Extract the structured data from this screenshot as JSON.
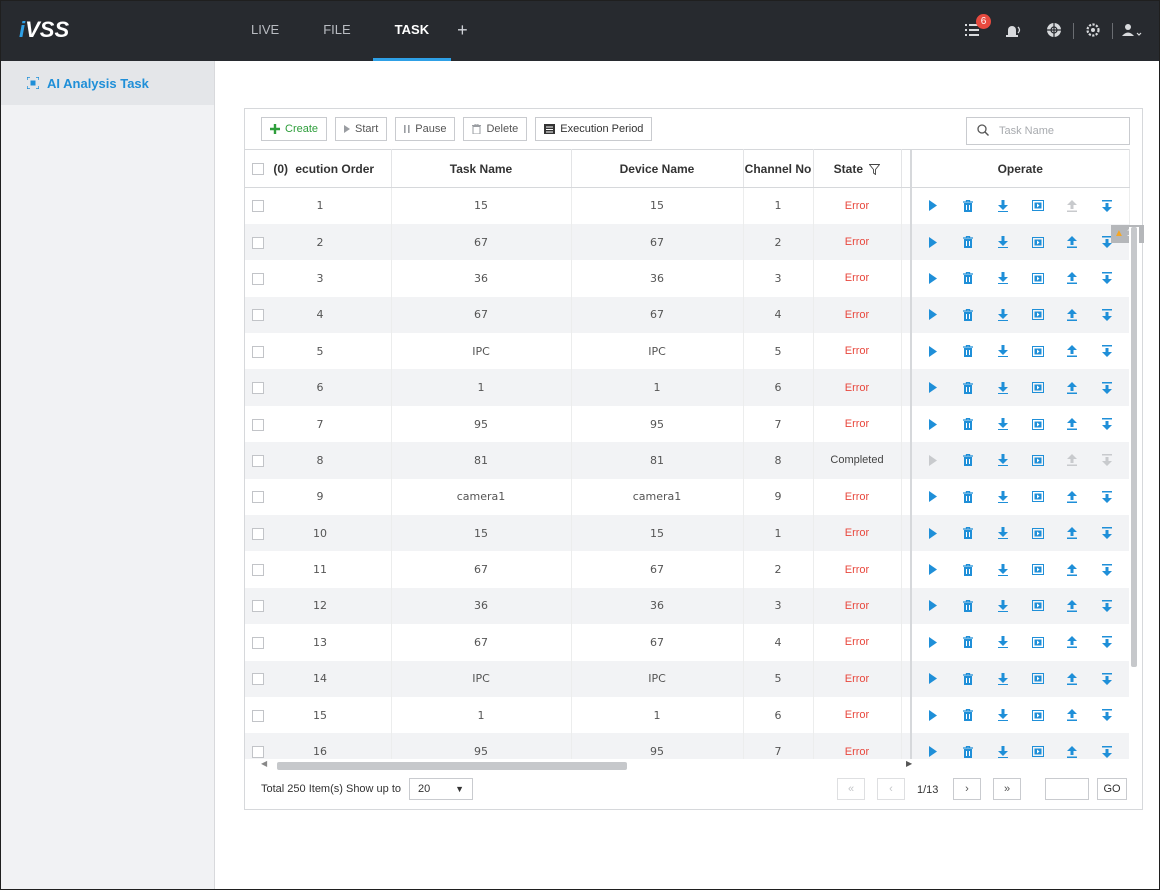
{
  "app": {
    "logo_prefix": "i",
    "logo_rest": "VSS"
  },
  "nav": {
    "tabs": [
      {
        "label": "LIVE"
      },
      {
        "label": "FILE"
      },
      {
        "label": "TASK"
      }
    ],
    "add_label": "+",
    "active_tab": "TASK"
  },
  "header_tools": {
    "alarm_count": "6",
    "icons": [
      "task-list-icon",
      "alarm-icon",
      "globe-icon",
      "settings-icon",
      "user-icon"
    ]
  },
  "sidebar": {
    "items": [
      {
        "label": "AI Analysis Task",
        "icon": "ai-task-icon"
      }
    ]
  },
  "toolbar": {
    "create_label": "Create",
    "start_label": "Start",
    "pause_label": "Pause",
    "delete_label": "Delete",
    "execution_period_label": "Execution Period"
  },
  "search": {
    "placeholder": "Task Name",
    "value": ""
  },
  "table": {
    "select_count": "(0)",
    "columns": [
      "ecution Order",
      "Task Name",
      "Device Name",
      "Channel No",
      "State",
      "Operate"
    ],
    "rows": [
      {
        "order": "1",
        "task": "15",
        "device": "15",
        "channel": "1",
        "state": "Error"
      },
      {
        "order": "2",
        "task": "67",
        "device": "67",
        "channel": "2",
        "state": "Error"
      },
      {
        "order": "3",
        "task": "36",
        "device": "36",
        "channel": "3",
        "state": "Error"
      },
      {
        "order": "4",
        "task": "67",
        "device": "67",
        "channel": "4",
        "state": "Error"
      },
      {
        "order": "5",
        "task": "IPC",
        "device": "IPC",
        "channel": "5",
        "state": "Error"
      },
      {
        "order": "6",
        "task": "1",
        "device": "1",
        "channel": "6",
        "state": "Error"
      },
      {
        "order": "7",
        "task": "95",
        "device": "95",
        "channel": "7",
        "state": "Error"
      },
      {
        "order": "8",
        "task": "81",
        "device": "81",
        "channel": "8",
        "state": "Completed"
      },
      {
        "order": "9",
        "task": "camera1",
        "device": "camera1",
        "channel": "9",
        "state": "Error"
      },
      {
        "order": "10",
        "task": "15",
        "device": "15",
        "channel": "1",
        "state": "Error"
      },
      {
        "order": "11",
        "task": "67",
        "device": "67",
        "channel": "2",
        "state": "Error"
      },
      {
        "order": "12",
        "task": "36",
        "device": "36",
        "channel": "3",
        "state": "Error"
      },
      {
        "order": "13",
        "task": "67",
        "device": "67",
        "channel": "4",
        "state": "Error"
      },
      {
        "order": "14",
        "task": "IPC",
        "device": "IPC",
        "channel": "5",
        "state": "Error"
      },
      {
        "order": "15",
        "task": "1",
        "device": "1",
        "channel": "6",
        "state": "Error"
      },
      {
        "order": "16",
        "task": "95",
        "device": "95",
        "channel": "7",
        "state": "Error"
      }
    ],
    "warning_badge": "12"
  },
  "footer": {
    "total_text": "Total 250 Item(s) Show up to",
    "page_size": "20",
    "page_info": "1/13",
    "first_label": "«",
    "prev_label": "‹",
    "next_label": "›",
    "last_label": "»",
    "go_label": "GO",
    "page_input": ""
  },
  "colors": {
    "topbar": "#272a2f",
    "accent": "#2ea0e6",
    "error": "#e8483e",
    "create": "#2e9e3b",
    "op_blue": "#1f8fd8"
  }
}
